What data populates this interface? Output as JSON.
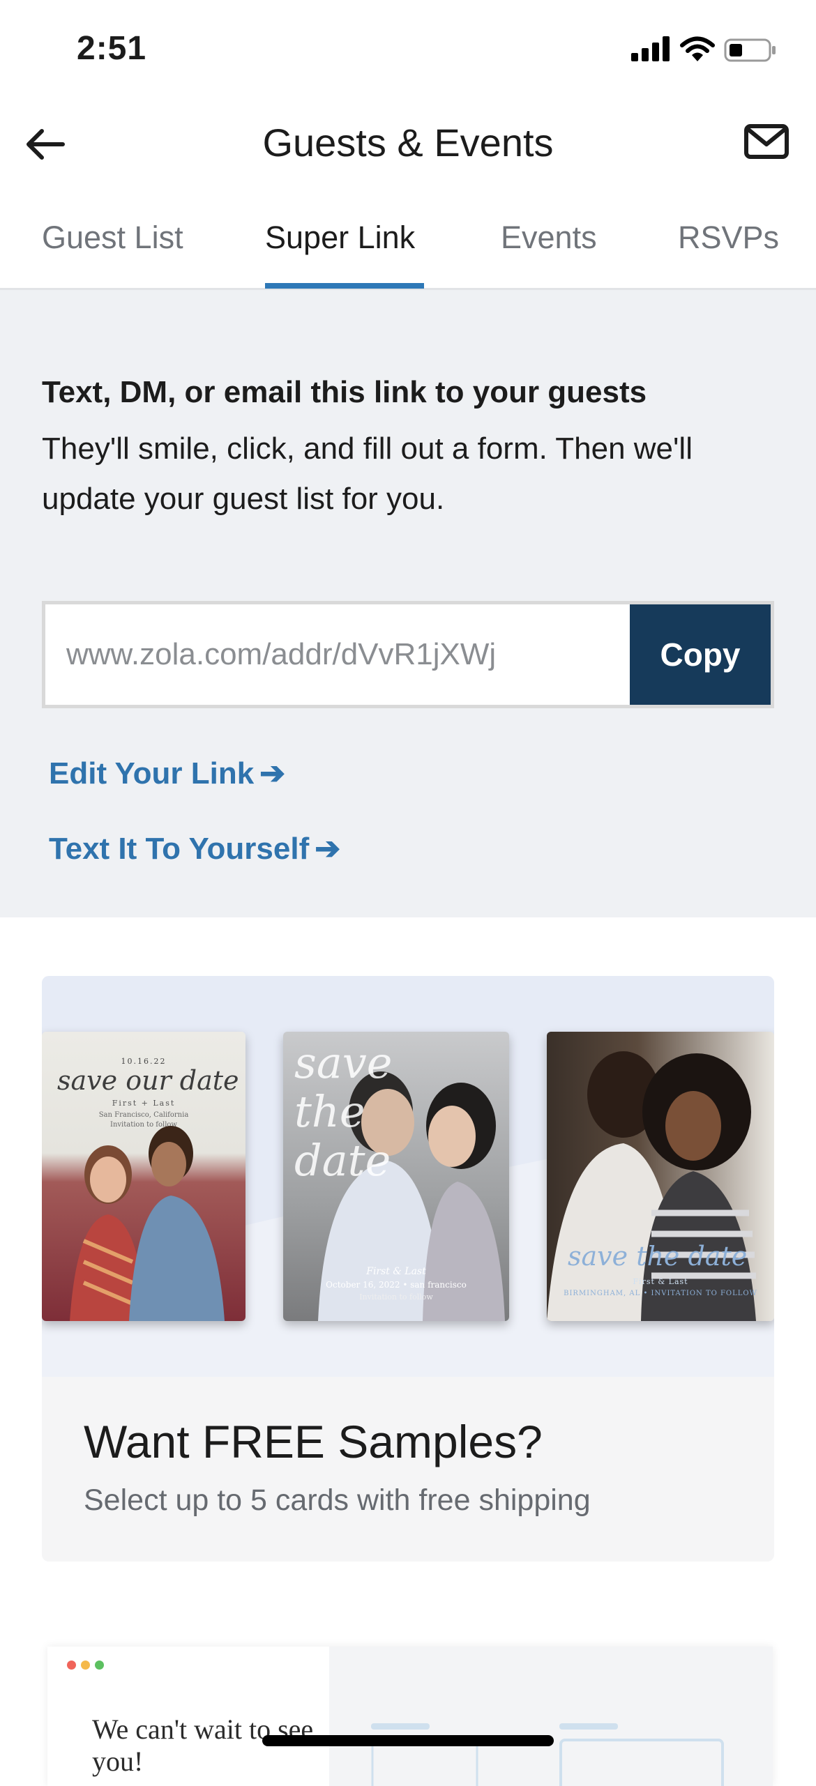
{
  "status_bar": {
    "time": "2:51"
  },
  "header": {
    "title": "Guests & Events"
  },
  "tabs": [
    {
      "label": "Guest List",
      "active": false
    },
    {
      "label": "Super Link",
      "active": true
    },
    {
      "label": "Events",
      "active": false
    },
    {
      "label": "RSVPs",
      "active": false
    }
  ],
  "super_link": {
    "heading": "Text, DM, or email this link to your guests",
    "description": "They'll smile, click, and fill out a form. Then we'll update your guest list for you.",
    "url": "www.zola.com/addr/dVvR1jXWj",
    "copy_label": "Copy",
    "edit_link_label": "Edit Your Link",
    "text_link_label": "Text It To Yourself",
    "arrow": "➔"
  },
  "samples": {
    "title": "Want FREE Samples?",
    "subtitle": "Select up to 5 cards with free shipping",
    "cards": [
      {
        "script_text": "save our date",
        "date": "10.16.22",
        "names": "First + Last",
        "location": "San Francisco, California",
        "note": "Invitation to follow"
      },
      {
        "script_text": "save the date",
        "names": "First & Last",
        "details": "October 16, 2022 • san francisco",
        "note": "Invitation to follow"
      },
      {
        "script_text": "save the date",
        "names": "First & Last",
        "details": "BIRMINGHAM, AL • INVITATION TO FOLLOW"
      }
    ]
  },
  "preview": {
    "headline": "We can't wait to see you!"
  },
  "colors": {
    "accent": "#2e78b7",
    "copy_button": "#163a5a",
    "link": "#2f73ad",
    "section_bg": "#eff1f4"
  }
}
